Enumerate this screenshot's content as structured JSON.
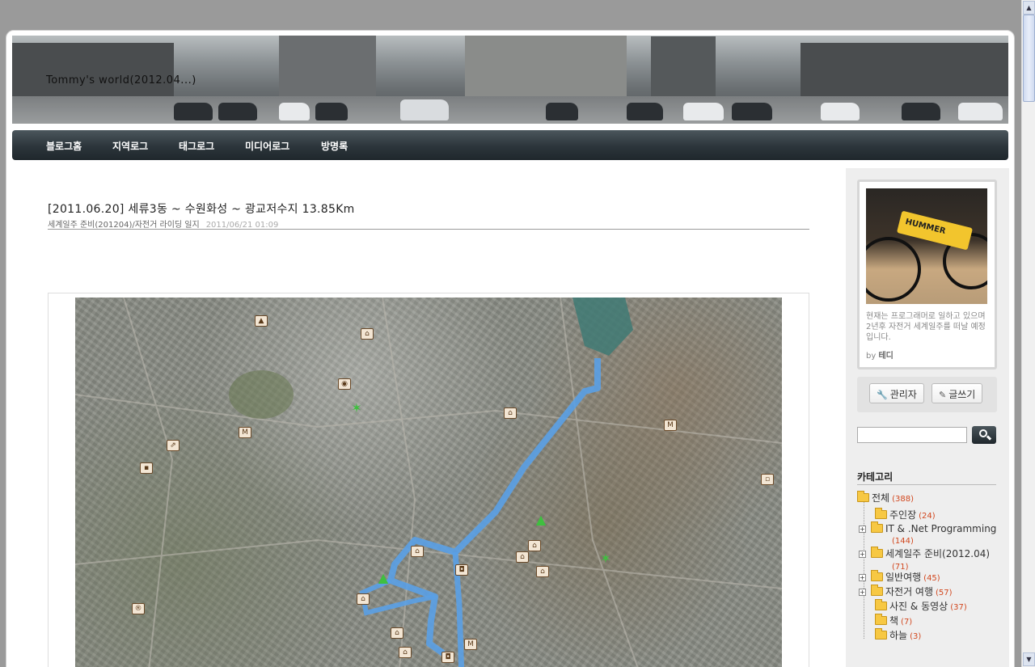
{
  "blog": {
    "title": "Tommy's world(2012.04...)"
  },
  "nav": {
    "items": [
      "블로그홈",
      "지역로그",
      "태그로그",
      "미디어로그",
      "방명록"
    ]
  },
  "post": {
    "title": "[2011.06.20] 세류3동 ~ 수원화성 ~ 광교저수지 13.85Km",
    "category": "세계일주 준비(201204)/자전거 라이딩 일지",
    "date": "2011/06/21 01:09"
  },
  "profile": {
    "photo_label": "HUMMER",
    "description": "현재는 프로그래머로 일하고 있으며 2년후 자전거 세계일주를 떠날 예정입니다.",
    "by_prefix": "by",
    "by_name": "테디"
  },
  "buttons": {
    "admin": "관리자",
    "write": "글쓰기"
  },
  "search": {
    "placeholder": ""
  },
  "categories": {
    "title": "카테고리",
    "items": [
      {
        "label": "전체",
        "count": "(388)"
      },
      {
        "label": "주인장",
        "count": "(24)"
      },
      {
        "label": "IT & .Net Programming",
        "count": "(144)"
      },
      {
        "label": "세계일주 준비(2012.04)",
        "count": "(71)"
      },
      {
        "label": "일반여행",
        "count": "(45)"
      },
      {
        "label": "자전거 여행",
        "count": "(57)"
      },
      {
        "label": "사진 & 동영상",
        "count": "(37)"
      },
      {
        "label": "책",
        "count": "(7)"
      },
      {
        "label": "하늘",
        "count": "(3)"
      }
    ]
  },
  "icons": {
    "admin": "wrench-icon",
    "write": "pencil-icon",
    "search": "search-icon",
    "folder": "folder-icon"
  },
  "colors": {
    "nav_bg": "#2c353b",
    "route": "#5aa0e6",
    "count": "#d2481f"
  }
}
